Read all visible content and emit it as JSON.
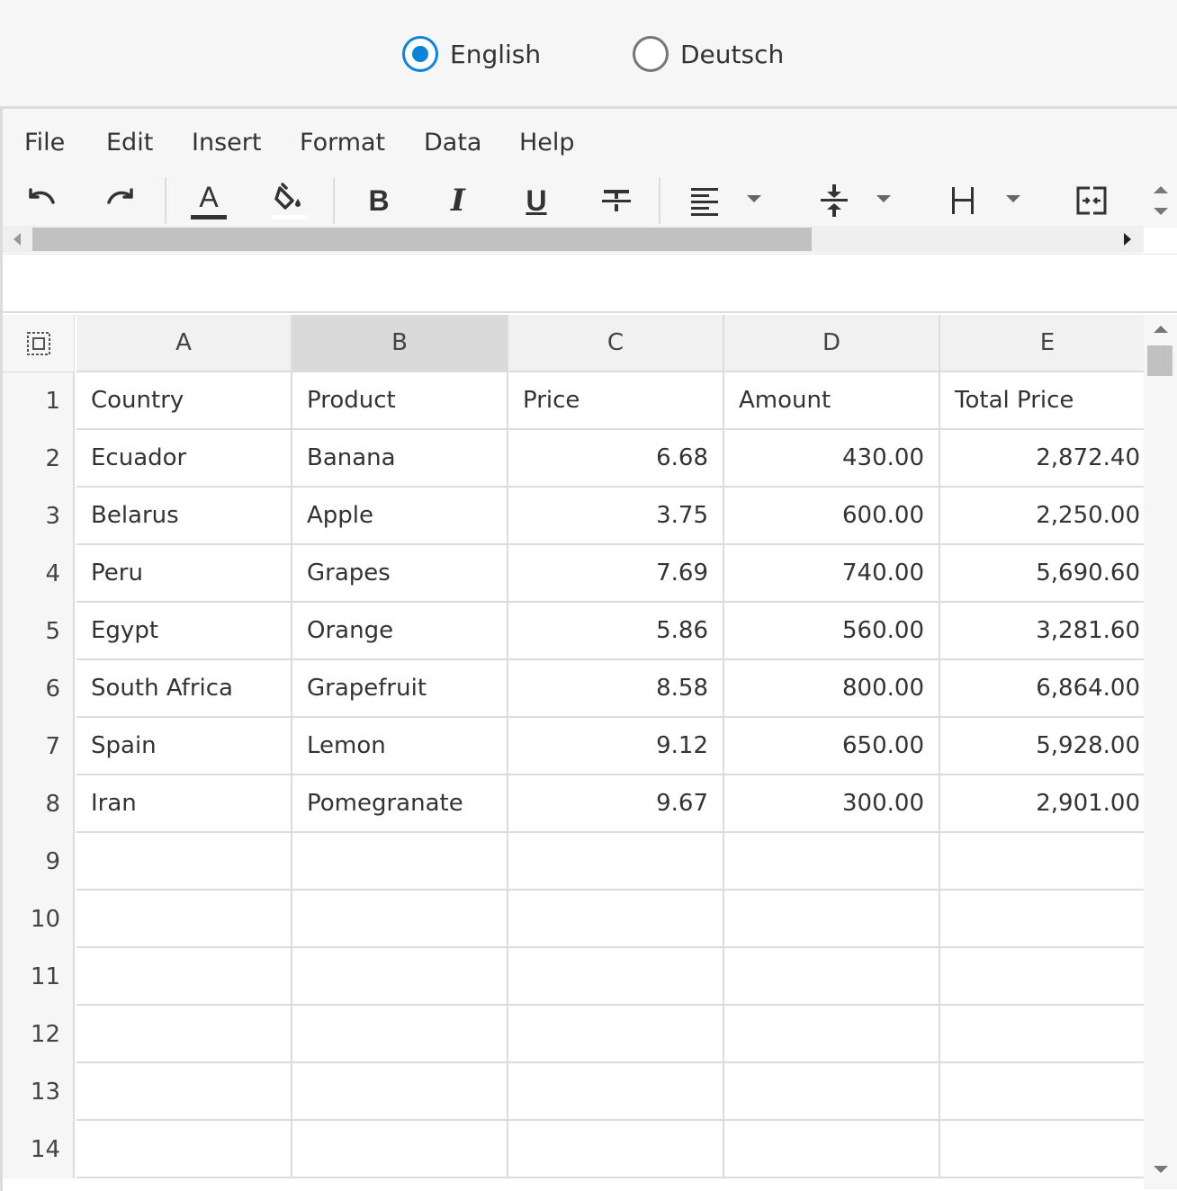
{
  "language": {
    "options": [
      {
        "label": "English",
        "checked": true
      },
      {
        "label": "Deutsch",
        "checked": false
      }
    ]
  },
  "menu": [
    "File",
    "Edit",
    "Insert",
    "Format",
    "Data",
    "Help"
  ],
  "toolbar": {
    "icons": [
      "undo-icon",
      "redo-icon",
      "font-color-icon",
      "fill-color-icon",
      "bold-icon",
      "italic-icon",
      "underline-icon",
      "strikethrough-icon",
      "align-left-icon",
      "vertical-align-icon",
      "column-width-icon",
      "merge-cells-icon"
    ],
    "font_color_glyph": "A",
    "bold_glyph": "B",
    "italic_glyph": "I",
    "underline_glyph": "U"
  },
  "colors": {
    "accent": "#0f83d8",
    "grid_line": "#dcdcdc",
    "header_bg": "#f1f1f1",
    "selected_header_bg": "#dadada"
  },
  "grid": {
    "columns": [
      "A",
      "B",
      "C",
      "D",
      "E"
    ],
    "selected_column": "B",
    "row_numbers": [
      "1",
      "2",
      "3",
      "4",
      "5",
      "6",
      "7",
      "8",
      "9",
      "10",
      "11",
      "12",
      "13",
      "14"
    ],
    "rows": [
      [
        "Country",
        "Product",
        "Price",
        "Amount",
        "Total Price"
      ],
      [
        "Ecuador",
        "Banana",
        "6.68",
        "430.00",
        "2,872.40"
      ],
      [
        "Belarus",
        "Apple",
        "3.75",
        "600.00",
        "2,250.00"
      ],
      [
        "Peru",
        "Grapes",
        "7.69",
        "740.00",
        "5,690.60"
      ],
      [
        "Egypt",
        "Orange",
        "5.86",
        "560.00",
        "3,281.60"
      ],
      [
        "South Africa",
        "Grapefruit",
        "8.58",
        "800.00",
        "6,864.00"
      ],
      [
        "Spain",
        "Lemon",
        "9.12",
        "650.00",
        "5,928.00"
      ],
      [
        "Iran",
        "Pomegranate",
        "9.67",
        "300.00",
        "2,901.00"
      ],
      [
        "",
        "",
        "",
        "",
        ""
      ],
      [
        "",
        "",
        "",
        "",
        ""
      ],
      [
        "",
        "",
        "",
        "",
        ""
      ],
      [
        "",
        "",
        "",
        "",
        ""
      ],
      [
        "",
        "",
        "",
        "",
        ""
      ],
      [
        "",
        "",
        "",
        "",
        ""
      ]
    ]
  }
}
